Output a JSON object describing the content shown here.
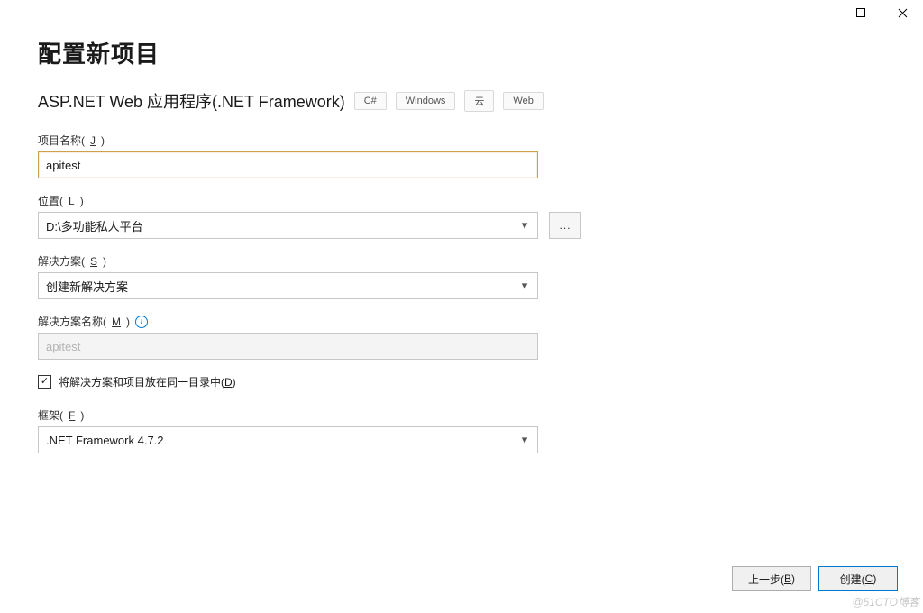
{
  "window": {
    "title": "配置新项目"
  },
  "template": {
    "name": "ASP.NET Web 应用程序(.NET Framework)",
    "tags": [
      "C#",
      "Windows",
      "云",
      "Web"
    ]
  },
  "fields": {
    "projectName": {
      "label_prefix": "项目名称(",
      "hotkey": "J",
      "label_suffix": ")",
      "value": "apitest"
    },
    "location": {
      "label_prefix": "位置(",
      "hotkey": "L",
      "label_suffix": ")",
      "value": "D:\\多功能私人平台"
    },
    "solution": {
      "label_prefix": "解决方案(",
      "hotkey": "S",
      "label_suffix": ")",
      "value": "创建新解决方案"
    },
    "solutionName": {
      "label_prefix": "解决方案名称(",
      "hotkey": "M",
      "label_suffix": ")",
      "placeholder": "apitest"
    },
    "sameDir": {
      "label_prefix": "将解决方案和项目放在同一目录中(",
      "hotkey": "D",
      "label_suffix": ")",
      "checked": true
    },
    "framework": {
      "label_prefix": "框架(",
      "hotkey": "F",
      "label_suffix": ")",
      "value": ".NET Framework 4.7.2"
    }
  },
  "buttons": {
    "browse": "...",
    "back_prefix": "上一步(",
    "back_hotkey": "B",
    "back_suffix": ")",
    "create_prefix": "创建(",
    "create_hotkey": "C",
    "create_suffix": ")"
  },
  "watermark": "@51CTO博客"
}
